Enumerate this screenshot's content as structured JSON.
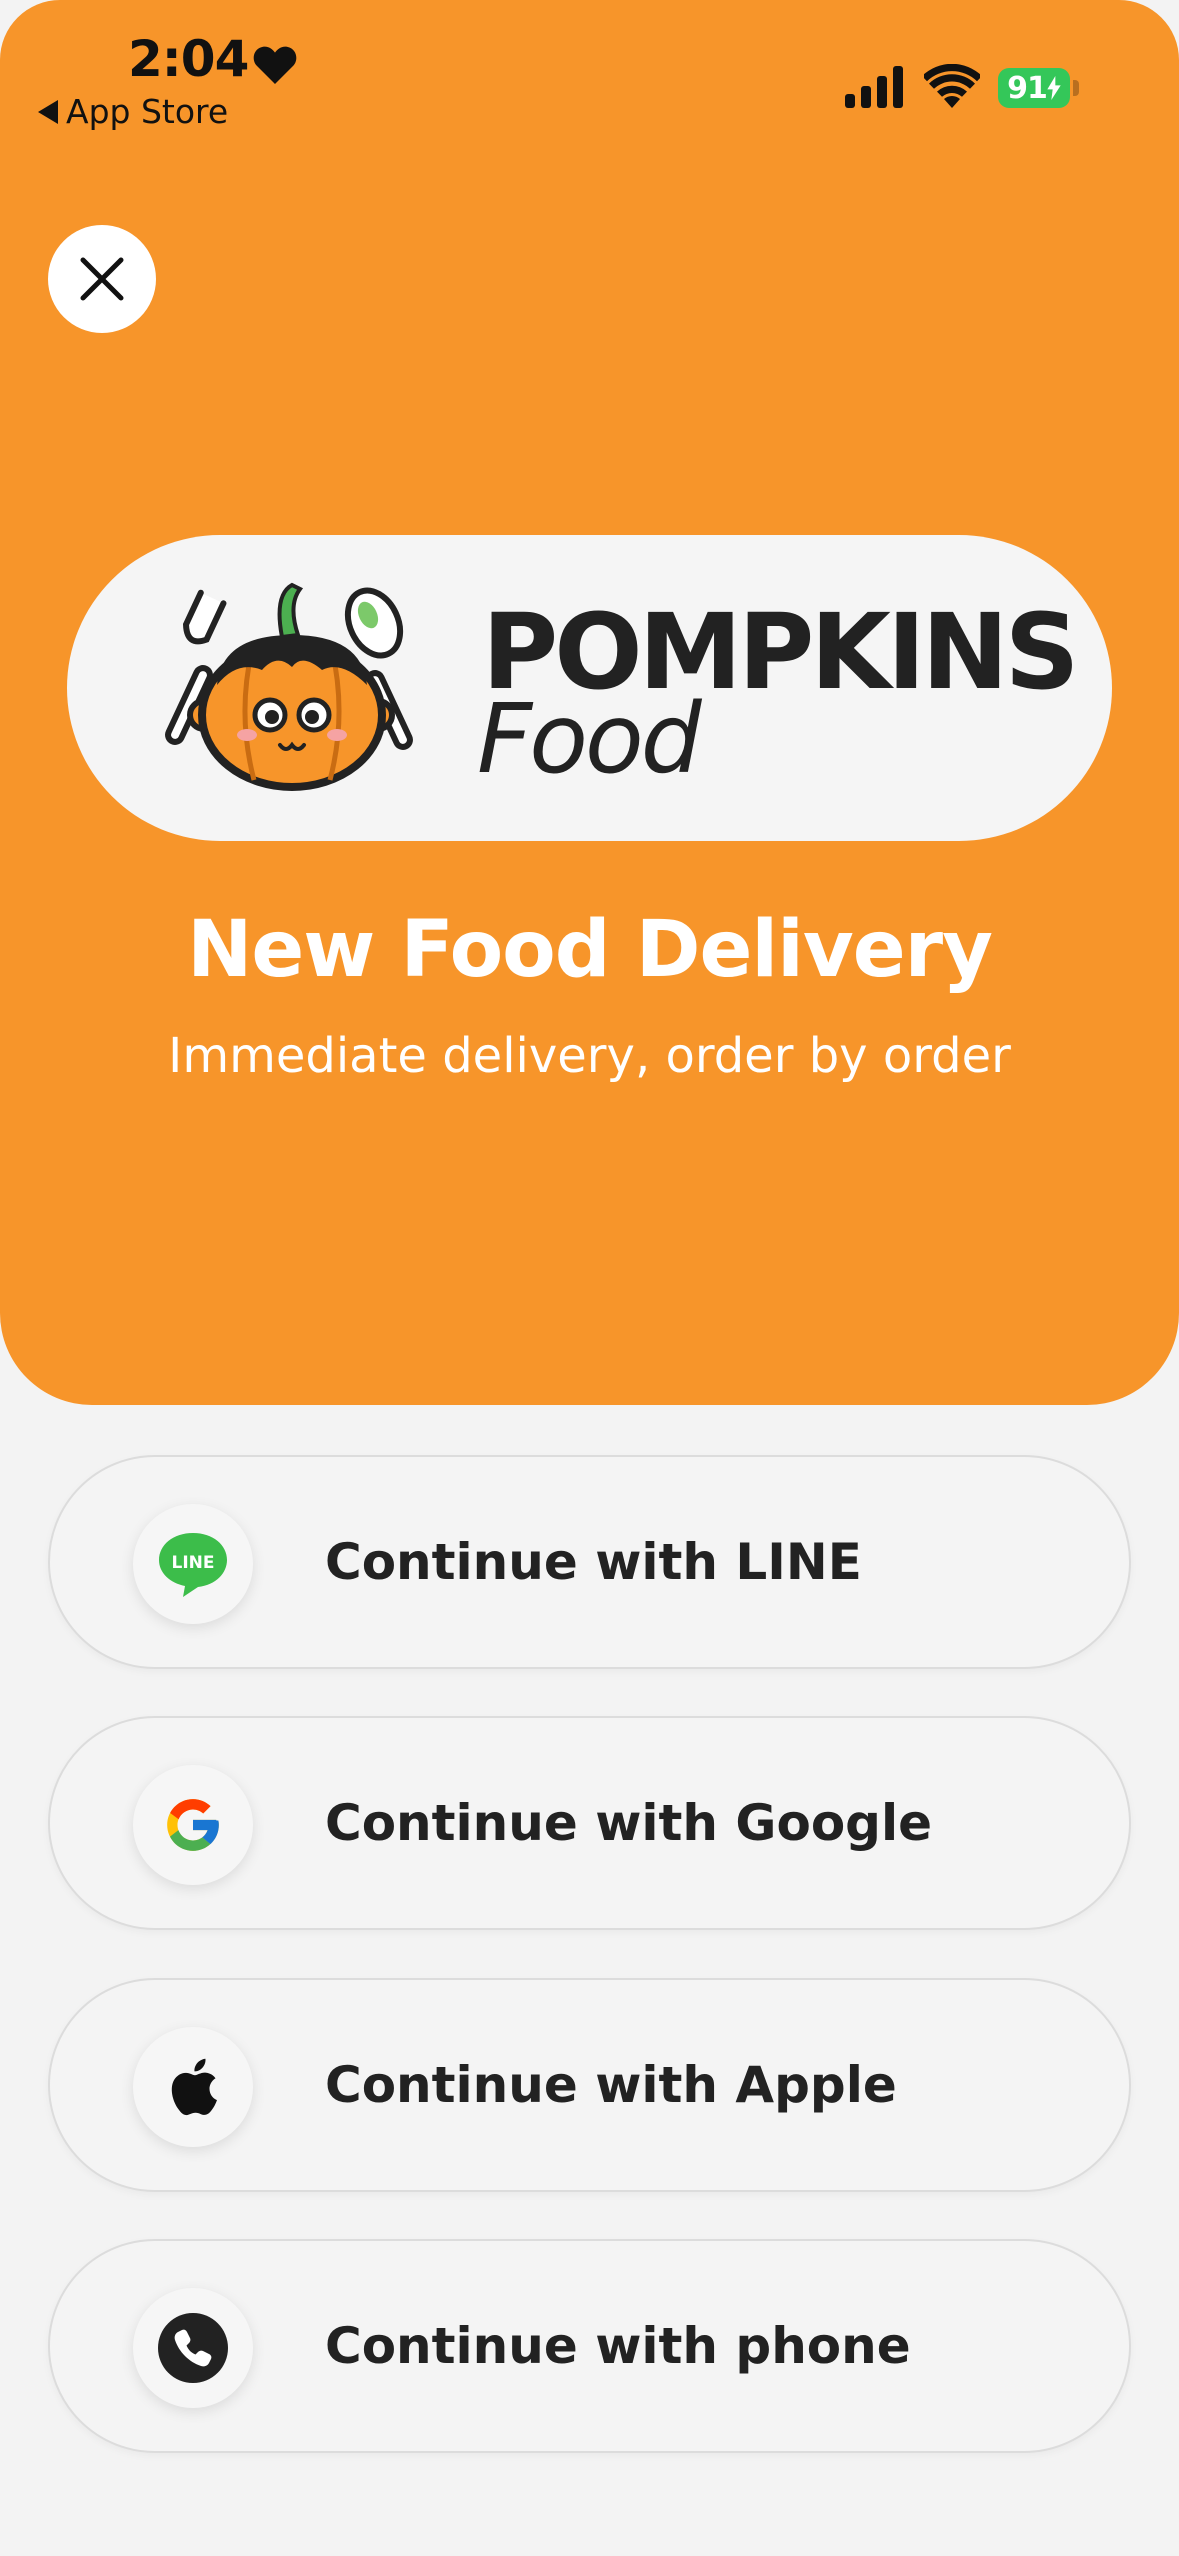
{
  "status_bar": {
    "time": "2:04",
    "back_label": "App Store",
    "battery": "91",
    "battery_color": "#34c759"
  },
  "hero": {
    "background": "#f7952a",
    "brand_line1": "POMPKINS",
    "brand_line2": "Food",
    "headline": "New Food Delivery",
    "subline": "Immediate delivery, order by order"
  },
  "login_options": [
    {
      "label": "Continue with LINE",
      "icon": "line-icon"
    },
    {
      "label": "Continue with Google",
      "icon": "google-icon"
    },
    {
      "label": "Continue with Apple",
      "icon": "apple-icon"
    },
    {
      "label": "Continue with phone",
      "icon": "phone-icon"
    }
  ],
  "line_icon_text": "LINE"
}
